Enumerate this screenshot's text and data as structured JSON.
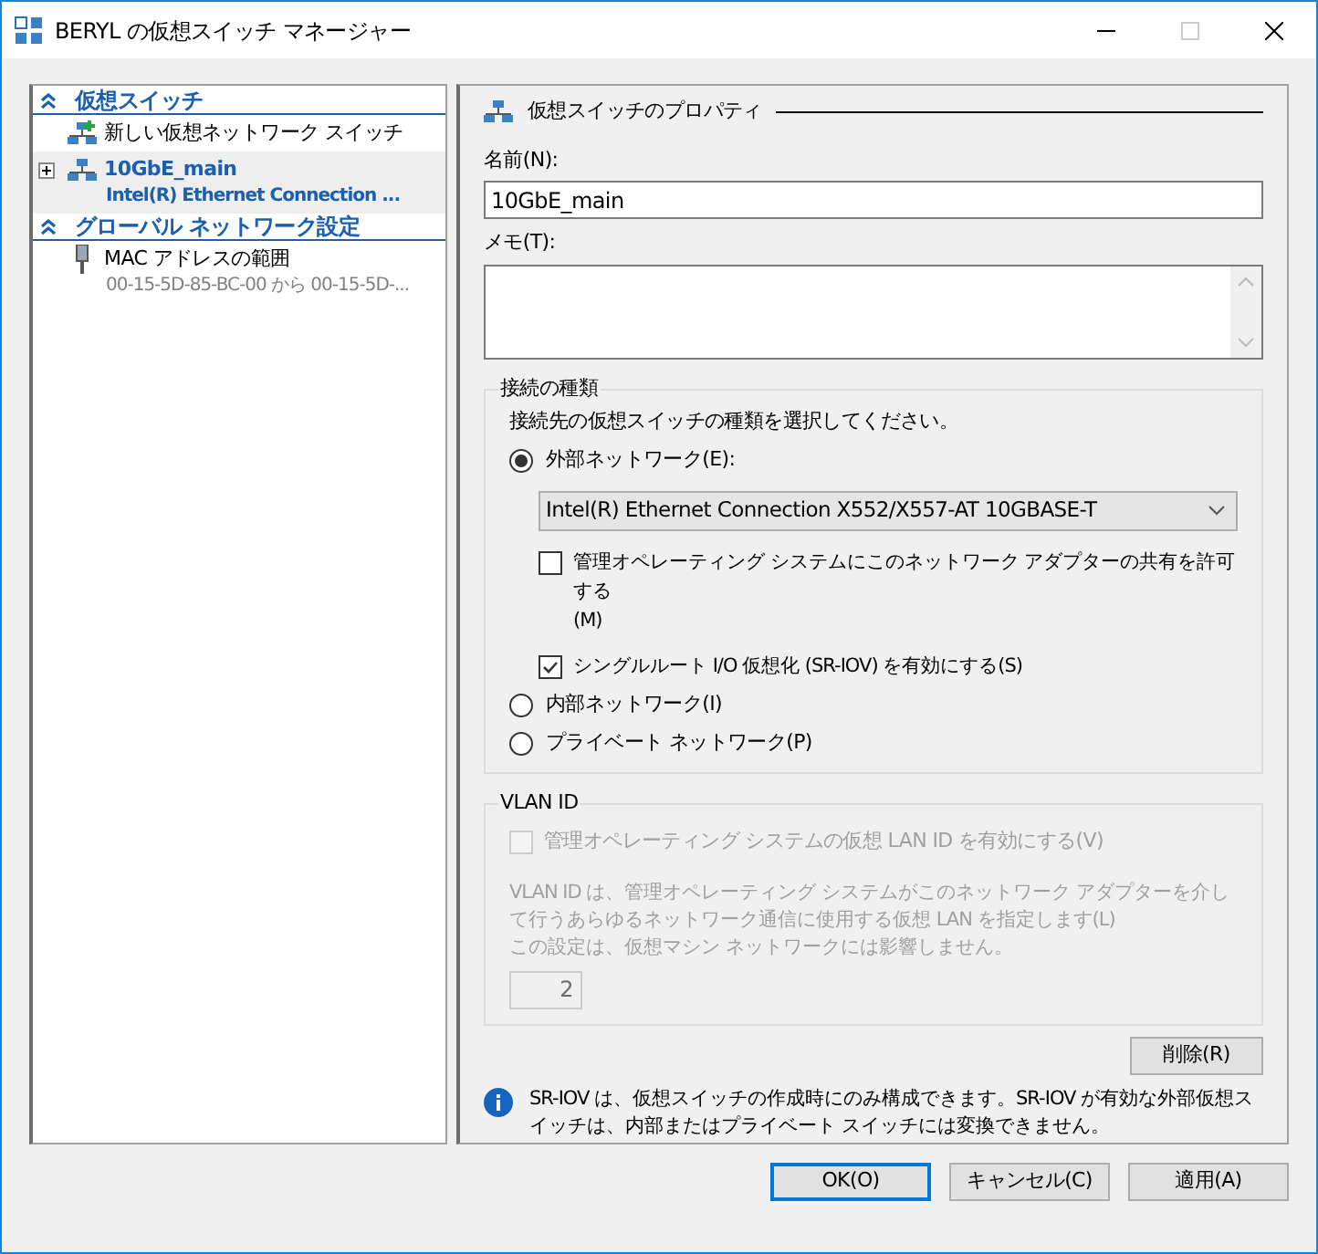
{
  "window": {
    "title": "BERYL の仮想スイッチ マネージャー"
  },
  "sidebar": {
    "sections": [
      {
        "title": "仮想スイッチ",
        "expanded": true,
        "items": [
          {
            "kind": "new",
            "label": "新しい仮想ネットワーク スイッチ",
            "selected": false
          },
          {
            "kind": "switch",
            "label": "10GbE_main",
            "detail": "Intel(R) Ethernet Connection ...",
            "selected": true,
            "expanded": false
          }
        ]
      },
      {
        "title": "グローバル ネットワーク設定",
        "expanded": true,
        "items": [
          {
            "kind": "mac",
            "label": "MAC アドレスの範囲",
            "detail": "00-15-5D-85-BC-00 から 00-15-5D-...",
            "selected": false
          }
        ]
      }
    ]
  },
  "properties": {
    "title": "仮想スイッチのプロパティ",
    "name_label": "名前(N):",
    "name_value": "10GbE_main",
    "memo_label": "メモ(T):",
    "connection": {
      "title": "接続の種類",
      "instruction": "接続先の仮想スイッチの種類を選択してください。",
      "options": [
        {
          "label": "外部ネットワーク(E):",
          "selected": true,
          "adapter": "Intel(R) Ethernet Connection X552/X557-AT 10GBASE-T",
          "checkboxes": [
            {
              "label": "管理オペレーティング システムにこのネットワーク アダプターの共有を許可する",
              "accel": "(M)",
              "checked": false
            },
            {
              "label": "シングルルート I/O 仮想化 (SR-IOV) を有効にする(S)",
              "checked": true
            }
          ]
        },
        {
          "label": "内部ネットワーク(I)",
          "selected": false
        },
        {
          "label": "プライベート ネットワーク(P)",
          "selected": false
        }
      ]
    },
    "vlan": {
      "title": "VLAN ID",
      "disabled": true,
      "checkbox": {
        "label": "管理オペレーティング システムの仮想 LAN ID を有効にする(V)",
        "checked": false
      },
      "paragraphs": [
        "VLAN ID は、管理オペレーティング システムがこのネットワーク アダプターを介して行うあらゆるネットワーク通信に使用する仮想 LAN を指定します(L)",
        "この設定は、仮想マシン ネットワークには影響しません。"
      ],
      "value": "2"
    },
    "delete_button": "削除(R)",
    "info": "SR-IOV は、仮想スイッチの作成時にのみ構成できます。SR-IOV が有効な外部仮想スイッチは、内部またはプライベート スイッチには変換できません。"
  },
  "buttons": [
    {
      "label": "OK(O)",
      "default": true
    },
    {
      "label": "キャンセル(C)",
      "default": false
    },
    {
      "label": "適用(A)",
      "default": false
    }
  ]
}
